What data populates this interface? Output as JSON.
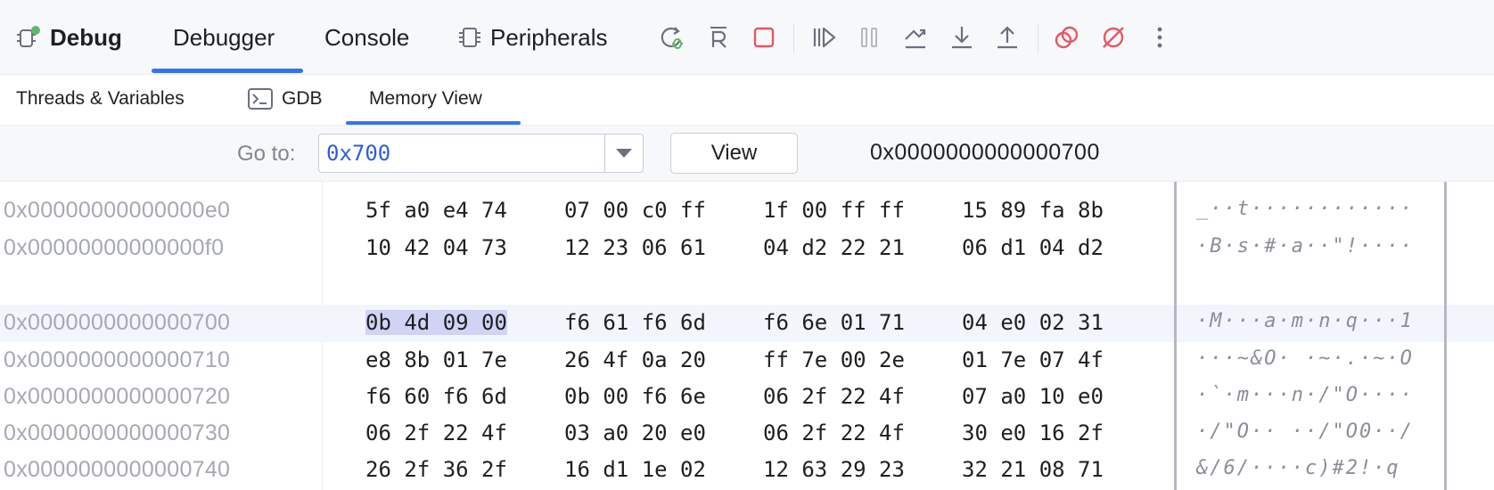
{
  "toolbar": {
    "title": "Debug",
    "tabs": [
      "Debugger",
      "Console",
      "Peripherals"
    ],
    "active_tab": "Debugger",
    "accent": "#3574f0",
    "icons": [
      "rerun-debug-icon",
      "restart-icon",
      "stop-icon",
      "resume-icon",
      "pause-icon",
      "step-over-icon",
      "step-into-icon",
      "step-out-icon",
      "view-breakpoints-icon",
      "mute-breakpoints-icon",
      "more-icon"
    ]
  },
  "subtabs": {
    "items": [
      "Threads & Variables",
      "GDB",
      "Memory View"
    ],
    "active": "Memory View"
  },
  "goto": {
    "label": "Go to:",
    "value": "0x700",
    "view_button": "View",
    "current_address": "0x0000000000000700"
  },
  "memory": {
    "rows": [
      {
        "addr": "0x00000000000000e0",
        "groups": [
          "5f a0 e4 74",
          "07 00 c0 ff",
          "1f 00 ff ff",
          "15 89 fa 8b"
        ],
        "ascii": "_··t············"
      },
      {
        "addr": "0x00000000000000f0",
        "groups": [
          "10 42 04 73",
          "12 23 06 61",
          "04 d2 22 21",
          "06 d1 04 d2"
        ],
        "ascii": "·B·s·#·a··\"!····"
      },
      {
        "addr": "0x0000000000000700",
        "groups": [
          "0b 4d 09 00",
          "f6 61 f6 6d",
          "f6 6e 01 71",
          "04 e0 02 31"
        ],
        "ascii": "·M···a·m·n·q···1"
      },
      {
        "addr": "0x0000000000000710",
        "groups": [
          "e8 8b 01 7e",
          "26 4f 0a 20",
          "ff 7e 00 2e",
          "01 7e 07 4f"
        ],
        "ascii": "···~&O· ·~·.·~·O"
      },
      {
        "addr": "0x0000000000000720",
        "groups": [
          "f6 60 f6 6d",
          "0b 00 f6 6e",
          "06 2f 22 4f",
          "07 a0 10 e0"
        ],
        "ascii": "·`·m···n·/\"O····"
      },
      {
        "addr": "0x0000000000000730",
        "groups": [
          "06 2f 22 4f",
          "03 a0 20 e0",
          "06 2f 22 4f",
          "30 e0 16 2f"
        ],
        "ascii": "·/\"O·· ··/\"O0··/"
      },
      {
        "addr": "0x0000000000000740",
        "groups": [
          "26 2f 36 2f",
          "16 d1 1e 02",
          "12 63 29 23",
          "32 21 08 71"
        ],
        "ascii": "&/6/····c)#2!·q"
      }
    ],
    "selected_row": 2,
    "selected_group": 0,
    "selection_color": "#d1d3f5"
  }
}
